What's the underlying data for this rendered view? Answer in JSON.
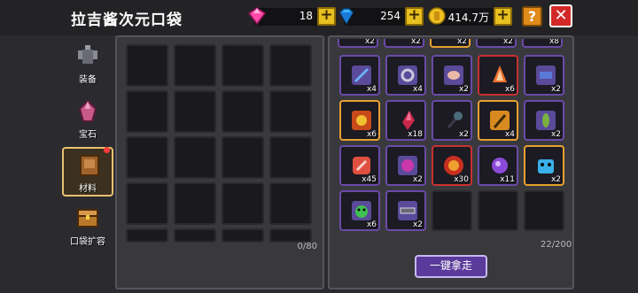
{
  "header": {
    "title": "拉吉酱次元口袋",
    "gems": "18",
    "diamonds": "254",
    "coins": "414.7万",
    "help": "?",
    "close": "✕"
  },
  "sidebar": {
    "items": [
      {
        "label": "装备"
      },
      {
        "label": "宝石"
      },
      {
        "label": "材料"
      },
      {
        "label": "口袋扩容"
      }
    ]
  },
  "left_panel": {
    "count": "0/80"
  },
  "right_panel": {
    "count": "22/200",
    "top_qty": [
      "x2",
      "x2",
      "x2",
      "x2",
      "x8"
    ],
    "rows": [
      [
        {
          "qty": "x4",
          "b": "purple"
        },
        {
          "qty": "x4",
          "b": "purple"
        },
        {
          "qty": "x2",
          "b": "purple"
        },
        {
          "qty": "x6",
          "b": "red"
        },
        {
          "qty": "x2",
          "b": "purple"
        }
      ],
      [
        {
          "qty": "x6",
          "b": "gold"
        },
        {
          "qty": "x18",
          "b": "purple"
        },
        {
          "qty": "x2",
          "b": "purple"
        },
        {
          "qty": "x4",
          "b": "gold"
        },
        {
          "qty": "x2",
          "b": "purple"
        }
      ],
      [
        {
          "qty": "x45",
          "b": "purple"
        },
        {
          "qty": "x2",
          "b": "purple"
        },
        {
          "qty": "x30",
          "b": "red"
        },
        {
          "qty": "x11",
          "b": "purple"
        },
        {
          "qty": "x2",
          "b": "gold"
        }
      ],
      [
        {
          "qty": "x6",
          "b": "purple"
        },
        {
          "qty": "x2",
          "b": "purple"
        },
        {
          "qty": "",
          "b": "empty"
        },
        {
          "qty": "",
          "b": "empty"
        },
        {
          "qty": "",
          "b": "empty"
        }
      ]
    ],
    "collect_all": "一键拿走"
  },
  "colors": {
    "accent_purple": "#6a4aa8",
    "gold": "#e8a030",
    "red": "#c83030"
  }
}
